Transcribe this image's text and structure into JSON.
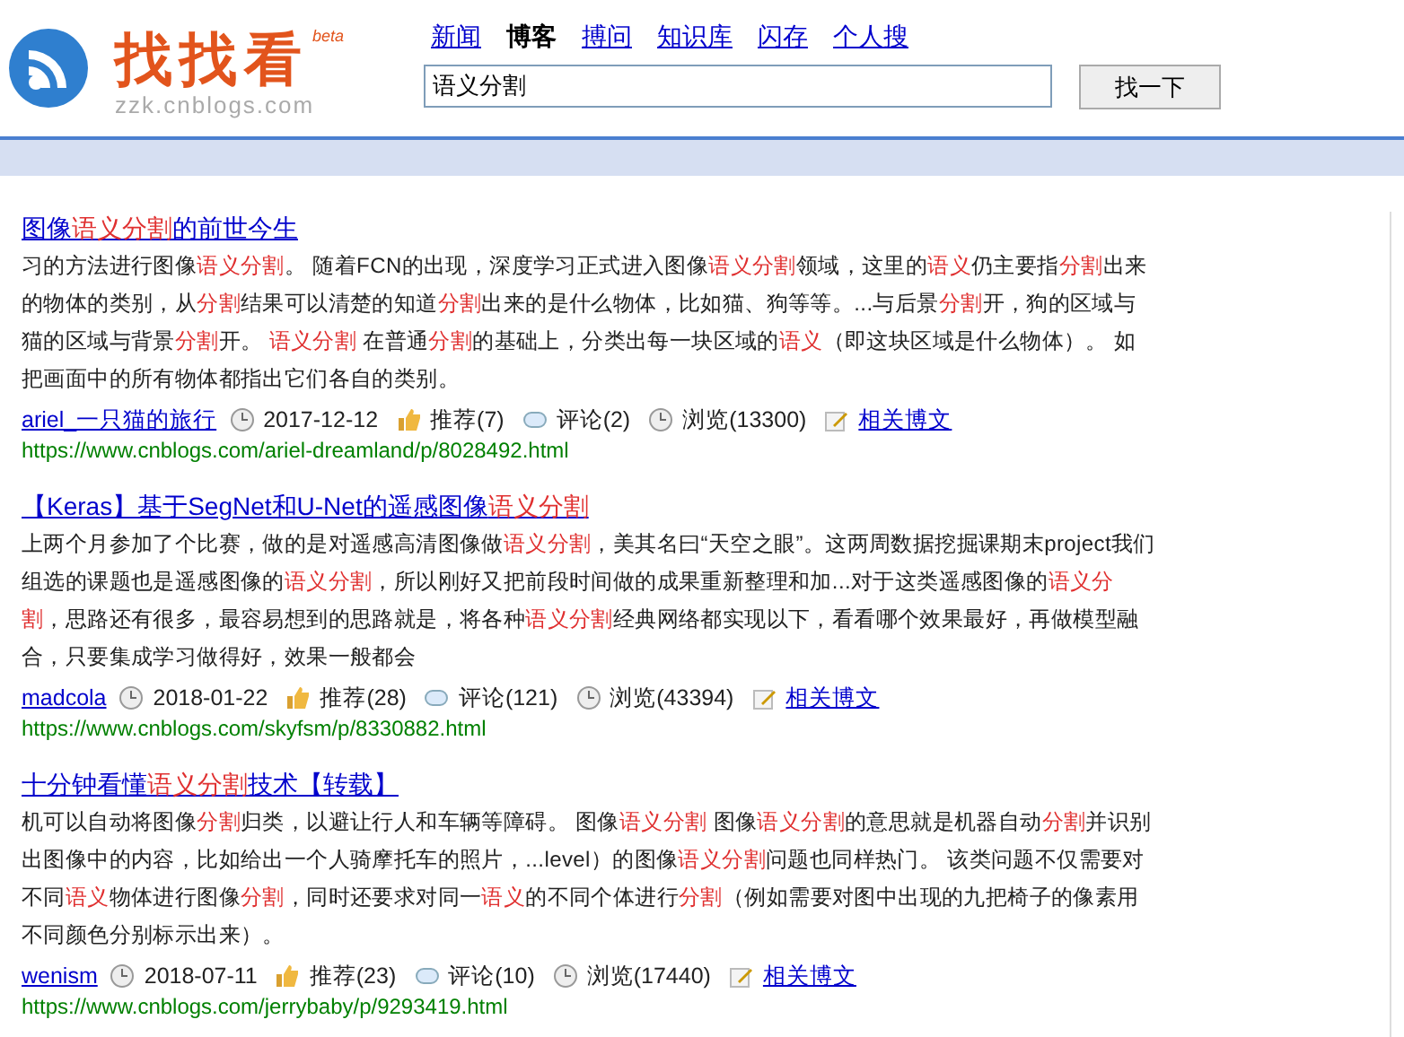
{
  "logo": {
    "title": "找找看",
    "badge": "beta",
    "domain": "zzk.cnblogs.com"
  },
  "nav": [
    {
      "label": "新闻",
      "selected": false
    },
    {
      "label": "博客",
      "selected": true
    },
    {
      "label": "搏问",
      "selected": false
    },
    {
      "label": "知识库",
      "selected": false
    },
    {
      "label": "闪存",
      "selected": false
    },
    {
      "label": "个人搜",
      "selected": false
    }
  ],
  "search": {
    "value": "语义分割",
    "button": "找一下"
  },
  "results": [
    {
      "title": [
        {
          "text": "图像",
          "highlight": false
        },
        {
          "text": "语义分割",
          "highlight": true
        },
        {
          "text": "的前世今生",
          "highlight": false
        }
      ],
      "snippet": [
        {
          "text": "习的方法进行图像",
          "highlight": false
        },
        {
          "text": "语义分割",
          "highlight": true
        },
        {
          "text": "。 随着FCN的出现，深度学习正式进入图像",
          "highlight": false
        },
        {
          "text": "语义分割",
          "highlight": true
        },
        {
          "text": "领域，这里的",
          "highlight": false
        },
        {
          "text": "语义",
          "highlight": true
        },
        {
          "text": "仍主要指",
          "highlight": false
        },
        {
          "text": "分割",
          "highlight": true
        },
        {
          "text": "出来的物体的类别，从",
          "highlight": false
        },
        {
          "text": "分割",
          "highlight": true
        },
        {
          "text": "结果可以清楚的知道",
          "highlight": false
        },
        {
          "text": "分割",
          "highlight": true
        },
        {
          "text": "出来的是什么物体，比如猫、狗等等。...与后景",
          "highlight": false
        },
        {
          "text": "分割",
          "highlight": true
        },
        {
          "text": "开，狗的区域与猫的区域与背景",
          "highlight": false
        },
        {
          "text": "分割",
          "highlight": true
        },
        {
          "text": "开。 ",
          "highlight": false
        },
        {
          "text": "语义分割",
          "highlight": true
        },
        {
          "text": " 在普通",
          "highlight": false
        },
        {
          "text": "分割",
          "highlight": true
        },
        {
          "text": "的基础上，分类出每一块区域的",
          "highlight": false
        },
        {
          "text": "语义",
          "highlight": true
        },
        {
          "text": "（即这块区域是什么物体）。 如把画面中的所有物体都指出它们各自的类别。",
          "highlight": false
        }
      ],
      "author": "ariel_一只猫的旅行",
      "date": "2017-12-12",
      "likes": "推荐(7)",
      "comments": "评论(2)",
      "views": "浏览(13300)",
      "related": "相关博文",
      "url": "https://www.cnblogs.com/ariel-dreamland/p/8028492.html"
    },
    {
      "title": [
        {
          "text": "【Keras】基于SegNet和U-Net的遥感图像",
          "highlight": false
        },
        {
          "text": "语义分割",
          "highlight": true
        }
      ],
      "snippet": [
        {
          "text": "上两个月参加了个比赛，做的是对遥感高清图像做",
          "highlight": false
        },
        {
          "text": "语义分割",
          "highlight": true
        },
        {
          "text": "，美其名曰“天空之眼”。这两周数据挖掘课期末project我们组选的课题也是遥感图像的",
          "highlight": false
        },
        {
          "text": "语义分割",
          "highlight": true
        },
        {
          "text": "，所以刚好又把前段时间做的成果重新整理和加...对于这类遥感图像的",
          "highlight": false
        },
        {
          "text": "语义分割",
          "highlight": true
        },
        {
          "text": "，思路还有很多，最容易想到的思路就是，将各种",
          "highlight": false
        },
        {
          "text": "语义分割",
          "highlight": true
        },
        {
          "text": "经典网络都实现以下，看看哪个效果最好，再做模型融合，只要集成学习做得好，效果一般都会",
          "highlight": false
        }
      ],
      "author": "madcola",
      "date": "2018-01-22",
      "likes": "推荐(28)",
      "comments": "评论(121)",
      "views": "浏览(43394)",
      "related": "相关博文",
      "url": "https://www.cnblogs.com/skyfsm/p/8330882.html"
    },
    {
      "title": [
        {
          "text": "十分钟看懂",
          "highlight": false
        },
        {
          "text": "语义分割",
          "highlight": true
        },
        {
          "text": "技术【转载】",
          "highlight": false
        }
      ],
      "snippet": [
        {
          "text": "机可以自动将图像",
          "highlight": false
        },
        {
          "text": "分割",
          "highlight": true
        },
        {
          "text": "归类，以避让行人和车辆等障碍。 图像",
          "highlight": false
        },
        {
          "text": "语义分割",
          "highlight": true
        },
        {
          "text": " 图像",
          "highlight": false
        },
        {
          "text": "语义分割",
          "highlight": true
        },
        {
          "text": "的意思就是机器自动",
          "highlight": false
        },
        {
          "text": "分割",
          "highlight": true
        },
        {
          "text": "并识别出图像中的内容，比如给出一个人骑摩托车的照片，...level）的图像",
          "highlight": false
        },
        {
          "text": "语义分割",
          "highlight": true
        },
        {
          "text": "问题也同样热门。 该类问题不仅需要对不同",
          "highlight": false
        },
        {
          "text": "语义",
          "highlight": true
        },
        {
          "text": "物体进行图像",
          "highlight": false
        },
        {
          "text": "分割",
          "highlight": true
        },
        {
          "text": "，同时还要求对同一",
          "highlight": false
        },
        {
          "text": "语义",
          "highlight": true
        },
        {
          "text": "的不同个体进行",
          "highlight": false
        },
        {
          "text": "分割",
          "highlight": true
        },
        {
          "text": "（例如需要对图中出现的九把椅子的像素用不同颜色分别标示出来）。",
          "highlight": false
        }
      ],
      "author": "wenism",
      "date": "2018-07-11",
      "likes": "推荐(23)",
      "comments": "评论(10)",
      "views": "浏览(17440)",
      "related": "相关博文",
      "url": "https://www.cnblogs.com/jerrybaby/p/9293419.html"
    }
  ]
}
